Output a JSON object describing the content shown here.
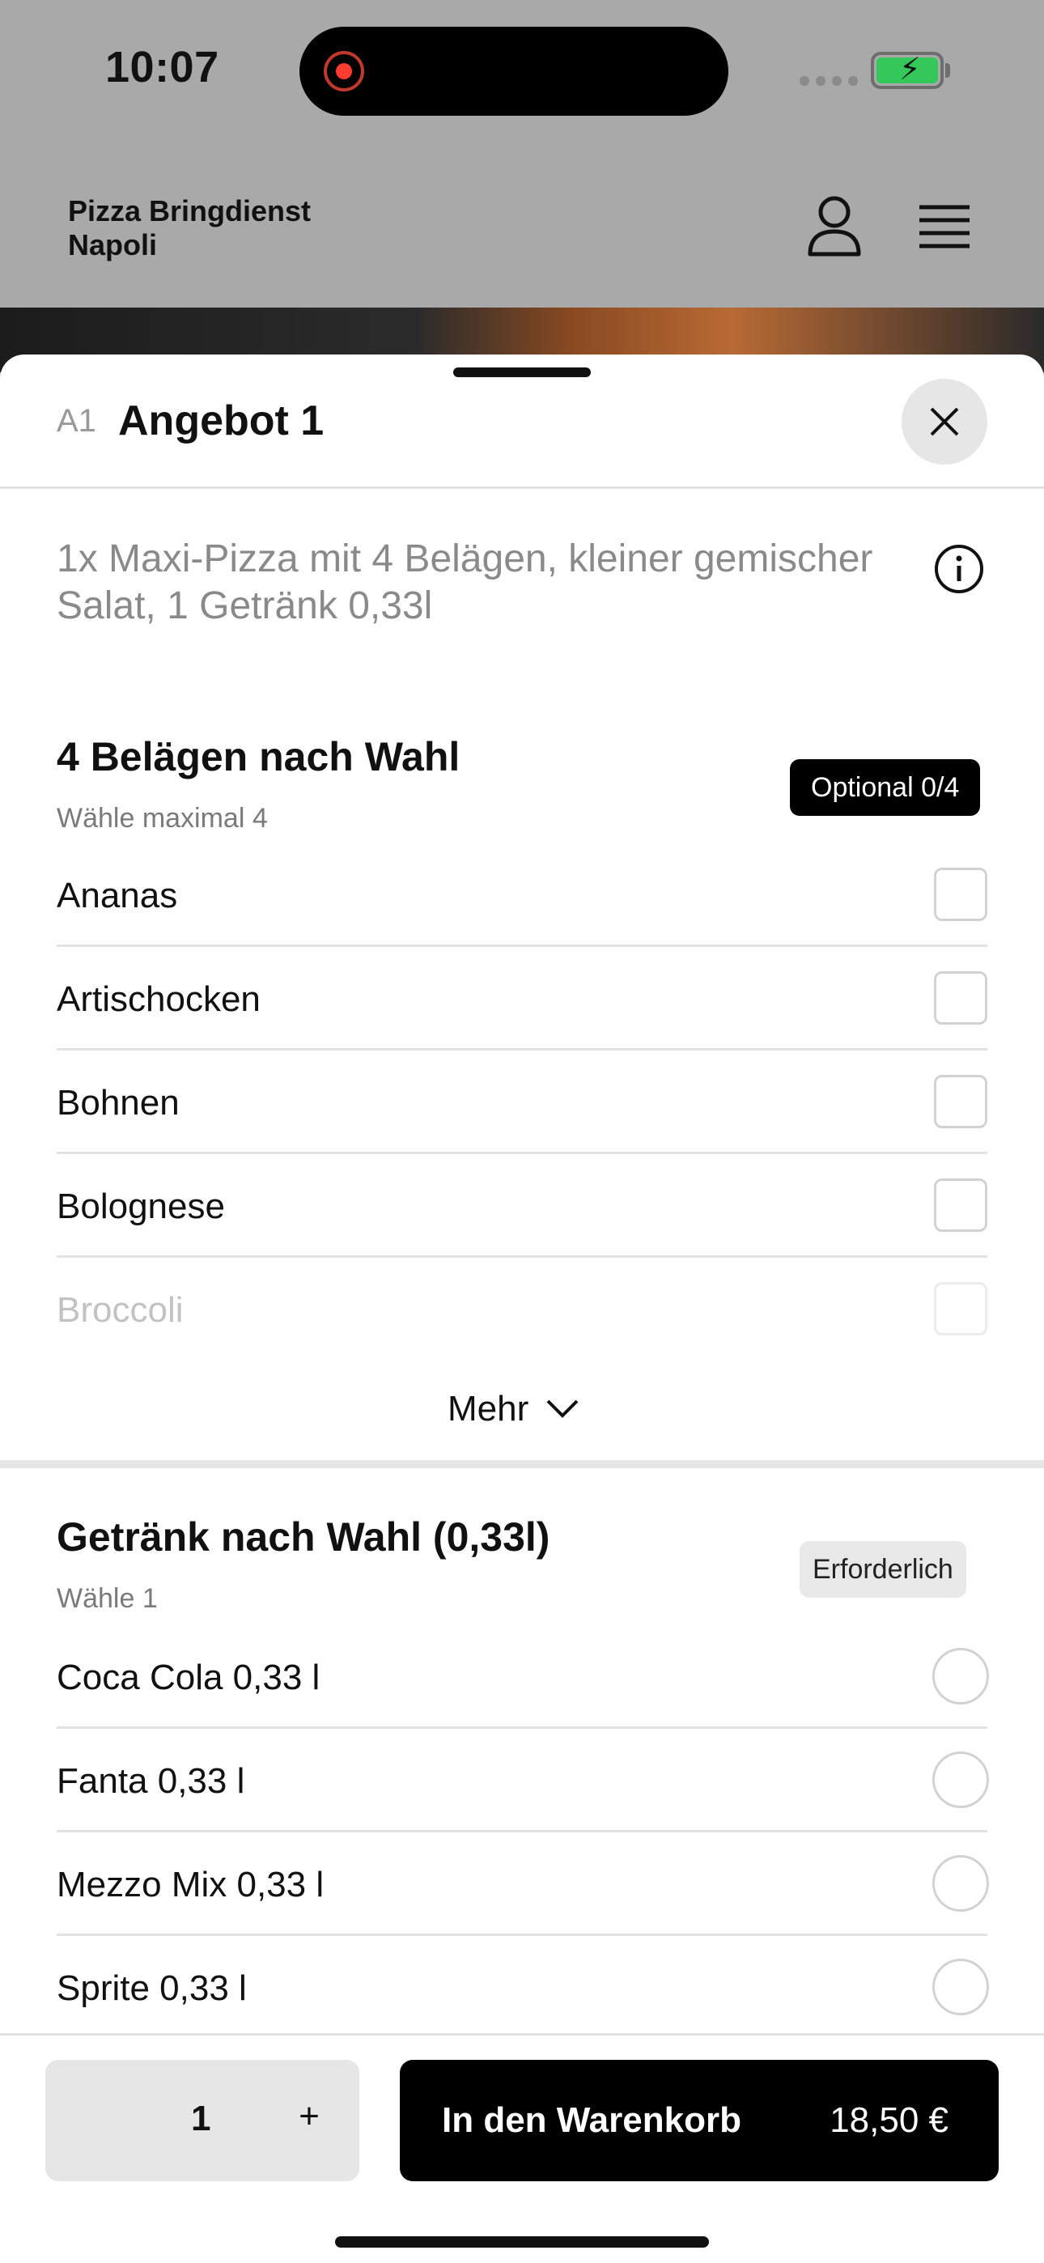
{
  "status_bar": {
    "time": "10:07"
  },
  "header": {
    "brand": "Pizza Bringdienst Napoli"
  },
  "sheet": {
    "code": "A1",
    "title": "Angebot 1",
    "description": "1x Maxi-Pizza mit 4 Belägen, kleiner gemischer Salat, 1 Getränk 0,33l"
  },
  "toppings": {
    "title": "4 Belägen nach Wahl",
    "subtitle": "Wähle maximal 4",
    "badge": "Optional 0/4",
    "items": [
      "Ananas",
      "Artischocken",
      "Bohnen",
      "Bolognese",
      "Broccoli"
    ],
    "more_label": "Mehr"
  },
  "drinks": {
    "title": "Getränk nach Wahl (0,33l)",
    "subtitle": "Wähle 1",
    "badge": "Erforderlich",
    "items": [
      "Coca Cola 0,33 l",
      "Fanta 0,33 l",
      "Mezzo Mix 0,33 l",
      "Sprite 0,33 l"
    ]
  },
  "bottom": {
    "quantity": "1",
    "plus": "+",
    "cart_label": "In den Warenkorb",
    "price": "18,50 €"
  },
  "colors": {
    "accent": "#000000",
    "success": "#34c759",
    "recording": "#ff3b30"
  },
  "icons": [
    "record-icon",
    "signal-icon",
    "battery-icon",
    "user-icon",
    "menu-icon",
    "close-icon",
    "info-icon",
    "chevron-down-icon",
    "plus-icon"
  ]
}
